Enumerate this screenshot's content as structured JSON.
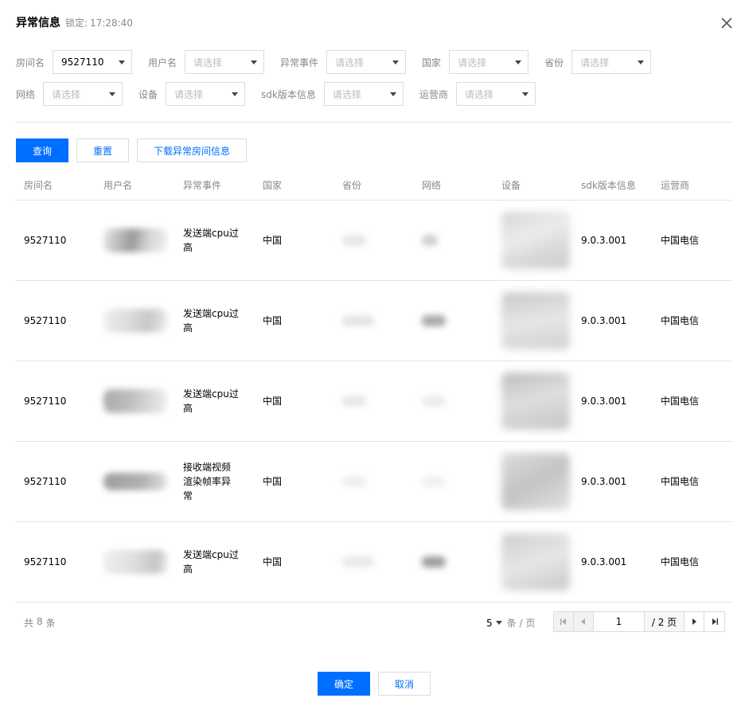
{
  "dialog": {
    "title": "异常信息",
    "lock_label": "锁定:",
    "lock_time": "17:28:40"
  },
  "filters": {
    "row1": [
      {
        "label": "房间名",
        "value": "9527110",
        "filled": true
      },
      {
        "label": "用户名",
        "value": "请选择",
        "filled": false
      },
      {
        "label": "异常事件",
        "value": "请选择",
        "filled": false
      },
      {
        "label": "国家",
        "value": "请选择",
        "filled": false
      },
      {
        "label": "省份",
        "value": "请选择",
        "filled": false
      }
    ],
    "row2": [
      {
        "label": "网络",
        "value": "请选择",
        "filled": false
      },
      {
        "label": "设备",
        "value": "请选择",
        "filled": false
      },
      {
        "label": "sdk版本信息",
        "value": "请选择",
        "filled": false
      },
      {
        "label": "运营商",
        "value": "请选择",
        "filled": false
      }
    ]
  },
  "actions": {
    "query": "查询",
    "reset": "重置",
    "download": "下载异常房间信息"
  },
  "table": {
    "columns": [
      "房间名",
      "用户名",
      "异常事件",
      "国家",
      "省份",
      "网络",
      "设备",
      "sdk版本信息",
      "运营商"
    ],
    "rows": [
      {
        "room": "9527110",
        "event": "发送端cpu过高",
        "country": "中国",
        "sdk": "9.0.3.001",
        "carrier": "中国电信"
      },
      {
        "room": "9527110",
        "event": "发送端cpu过高",
        "country": "中国",
        "sdk": "9.0.3.001",
        "carrier": "中国电信"
      },
      {
        "room": "9527110",
        "event": "发送端cpu过高",
        "country": "中国",
        "sdk": "9.0.3.001",
        "carrier": "中国电信"
      },
      {
        "room": "9527110",
        "event": "接收端视频渲染帧率异常",
        "country": "中国",
        "sdk": "9.0.3.001",
        "carrier": "中国电信"
      },
      {
        "room": "9527110",
        "event": "发送端cpu过高",
        "country": "中国",
        "sdk": "9.0.3.001",
        "carrier": "中国电信"
      }
    ]
  },
  "pagination": {
    "total_prefix": "共",
    "total_count": "8",
    "total_suffix": "条",
    "page_size": "5",
    "page_size_unit": "条 / 页",
    "current_page": "1",
    "total_pages": "/ 2 页"
  },
  "footer": {
    "ok": "确定",
    "cancel": "取消"
  },
  "colors": {
    "primary": "#006eff",
    "border": "#dcdcdc",
    "muted_text": "#888888"
  }
}
